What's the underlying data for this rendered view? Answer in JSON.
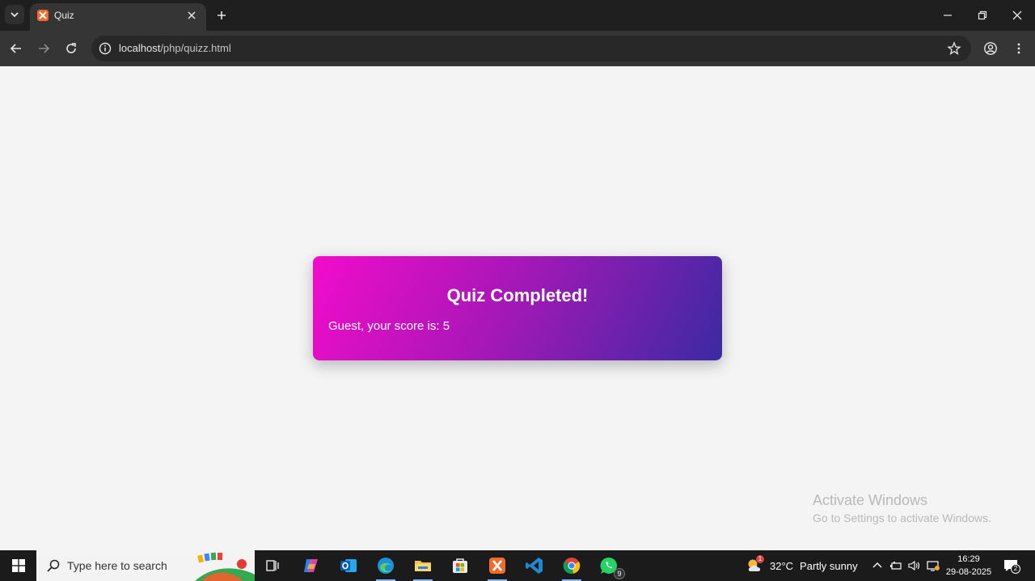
{
  "browser": {
    "tab_title": "Quiz",
    "url_host": "localhost",
    "url_path": "/php/quizz.html"
  },
  "page": {
    "heading": "Quiz Completed!",
    "score_text": "Guest, your score is: 5"
  },
  "watermark": {
    "line1": "Activate Windows",
    "line2": "Go to Settings to activate Windows."
  },
  "taskbar": {
    "search_placeholder": "Type here to search",
    "weather_temp": "32°C",
    "weather_desc": "Partly sunny",
    "weather_badge": "1",
    "whatsapp_badge": "9",
    "notification_count": "2",
    "time": "16:29",
    "date": "29-08-2025"
  },
  "colors": {
    "card_gradient": [
      "#f20ccb",
      "#a917b8",
      "#3b2aa2"
    ],
    "taskbar": "#1b1b1b",
    "browser_toolbar": "#353535"
  }
}
